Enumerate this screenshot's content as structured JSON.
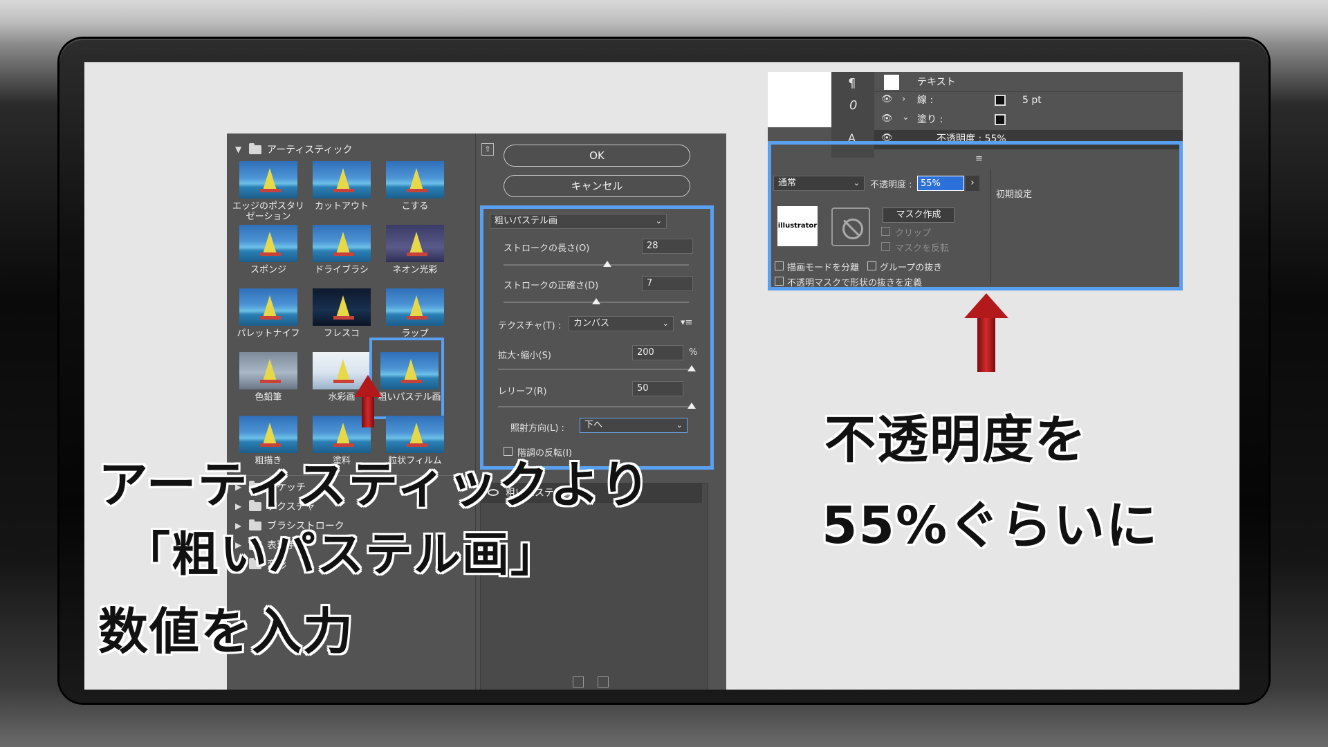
{
  "filter_dialog": {
    "category_open": "アーティスティック",
    "thumbnails": [
      {
        "label": "エッジのポスタリゼーション"
      },
      {
        "label": "カットアウト"
      },
      {
        "label": "こする"
      },
      {
        "label": "スポンジ"
      },
      {
        "label": "ドライブラシ"
      },
      {
        "label": "ネオン光彩"
      },
      {
        "label": "パレットナイフ"
      },
      {
        "label": "フレスコ"
      },
      {
        "label": "ラップ"
      },
      {
        "label": "色鉛筆"
      },
      {
        "label": "水彩画"
      },
      {
        "label": "粗いパステル画"
      },
      {
        "label": "粗描き"
      },
      {
        "label": "塗料"
      },
      {
        "label": "粒状フィルム"
      }
    ],
    "selected_thumbnail": "粗いパステル画",
    "categories_closed": [
      "スケッチ",
      "テクスチャ",
      "ブラシストローク",
      "表現手法",
      "変形"
    ],
    "ok_label": "OK",
    "cancel_label": "キャンセル",
    "filter_select": "粗いパステル画",
    "stroke_length_label": "ストロークの長さ(O)",
    "stroke_length_value": "28",
    "stroke_length_level": 0.56,
    "stroke_detail_label": "ストロークの正確さ(D)",
    "stroke_detail_value": "7",
    "stroke_detail_level": 0.5,
    "texture_label": "テクスチャ(T) :",
    "texture_value": "カンバス",
    "scaling_label": "拡大･縮小(S)",
    "scaling_value": "200",
    "scaling_unit": "%",
    "scaling_level": 1.0,
    "relief_label": "レリーフ(R)",
    "relief_value": "50",
    "relief_level": 1.0,
    "light_label": "照射方向(L) :",
    "light_value": "下へ",
    "invert_label": "階調の反転(I)",
    "effect_layer": "粗いパステル画"
  },
  "appearance_panel": {
    "text_label": "テキスト",
    "stroke_label": "線 :",
    "stroke_value": "5 pt",
    "fill_label": "塗り :",
    "opacity_row": "不透明度 : 55%",
    "blend_mode": "通常",
    "opacity_label": "不透明度 :",
    "opacity_value": "55%",
    "reset_label": "初期設定",
    "make_mask": "マスク作成",
    "clip": "クリップ",
    "invert_mask": "マスクを反転",
    "thumb_text": "illustrator",
    "isolate_blending": "描画モードを分離",
    "knockout_group": "グループの抜き",
    "opacity_mask_define": "不透明マスクで形状の抜きを定義"
  },
  "annotations": {
    "left_line1": "アーティスティックより",
    "left_line2": "「粗いパステル画」",
    "left_line3": "数値を入力",
    "right_line1": "不透明度を",
    "right_line2": "55%ぐらいに"
  },
  "colors": {
    "highlight": "#5aa0f0",
    "arrow": "#b3191b",
    "panel": "#535353"
  }
}
